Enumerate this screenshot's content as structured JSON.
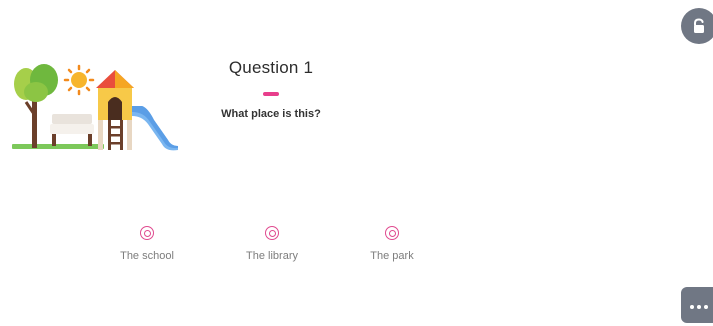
{
  "question": {
    "title": "Question 1",
    "prompt": "What place is this?",
    "accent_color": "#e83e8c",
    "illustration_icon": "playground-icon"
  },
  "options": [
    {
      "label": "The school",
      "selected": false
    },
    {
      "label": "The library",
      "selected": false
    },
    {
      "label": "The park",
      "selected": false
    }
  ],
  "controls": {
    "lock_button_icon": "lock-icon",
    "more_button_icon": "more-dots-icon",
    "button_color": "#707784"
  }
}
